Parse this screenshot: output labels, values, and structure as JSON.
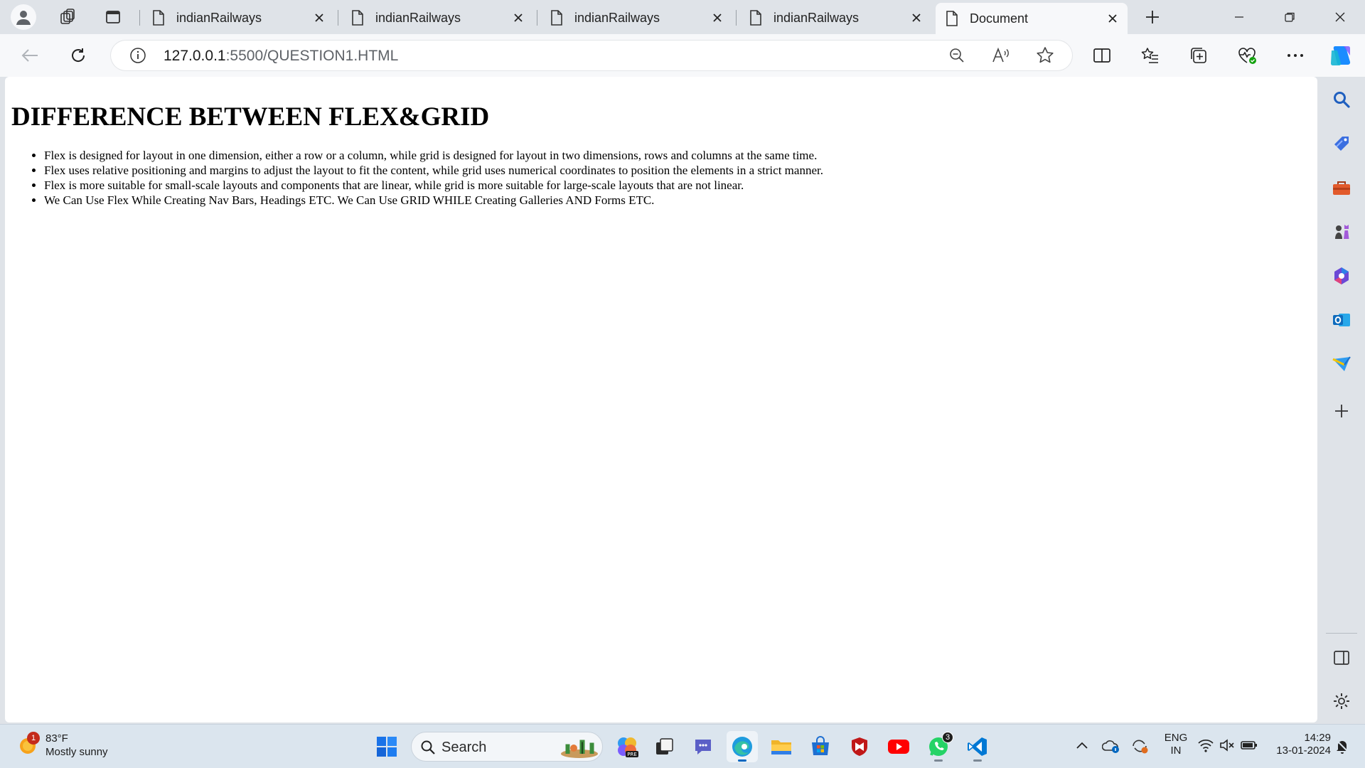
{
  "browser": {
    "tabs": [
      {
        "title": "indianRailways",
        "active": false
      },
      {
        "title": "indianRailways",
        "active": false
      },
      {
        "title": "indianRailways",
        "active": false
      },
      {
        "title": "indianRailways",
        "active": false
      },
      {
        "title": "Document",
        "active": true
      }
    ],
    "address": {
      "host": "127.0.0.1",
      "rest": ":5500/QUESTION1.HTML"
    }
  },
  "page": {
    "heading": "DIFFERENCE BETWEEN FLEX&GRID",
    "items": [
      "Flex is designed for layout in one dimension, either a row or a column, while grid is designed for layout in two dimensions, rows and columns at the same time.",
      "Flex uses relative positioning and margins to adjust the layout to fit the content, while grid uses numerical coordinates to position the elements in a strict manner.",
      "Flex is more suitable for small-scale layouts and components that are linear, while grid is more suitable for large-scale layouts that are not linear.",
      "We Can Use Flex While Creating Nav Bars, Headings ETC. We Can Use GRID WHILE Creating Galleries AND Forms ETC."
    ]
  },
  "taskbar": {
    "weather": {
      "temp": "83°F",
      "condition": "Mostly sunny",
      "alerts": "1"
    },
    "search_label": "Search",
    "whatsapp_badge": "3",
    "language": {
      "line1": "ENG",
      "line2": "IN"
    },
    "clock": {
      "time": "14:29",
      "date": "13-01-2024"
    }
  },
  "colors": {
    "accent": "#0078d4",
    "chrome": "#dfe3e8",
    "toolbar": "#f7f8fa",
    "taskbar": "#dbe5ee"
  }
}
